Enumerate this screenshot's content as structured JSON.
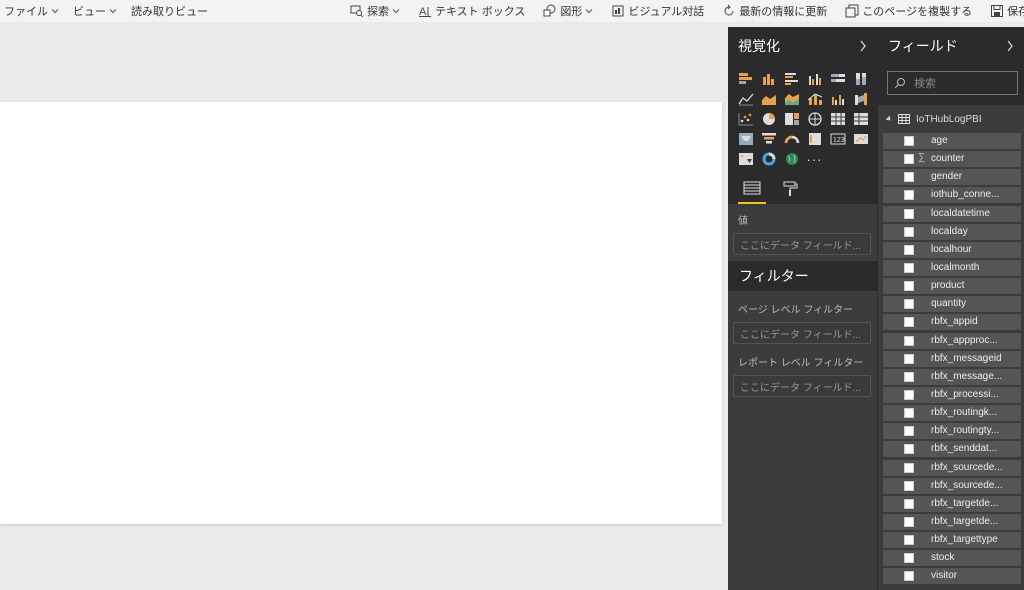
{
  "toolbar": {
    "left": [
      {
        "label": "ファイル"
      },
      {
        "label": "ビュー"
      },
      {
        "label": "読み取りビュー"
      }
    ],
    "right": [
      {
        "label": "探索",
        "icon": "explore-icon",
        "dropdown": true
      },
      {
        "label": "テキスト ボックス",
        "icon": "textbox-icon"
      },
      {
        "label": "図形",
        "icon": "shapes-icon",
        "dropdown": true
      },
      {
        "label": "ビジュアル対話",
        "icon": "visual-interaction-icon"
      },
      {
        "label": "最新の情報に更新",
        "icon": "refresh-icon"
      },
      {
        "label": "このページを複製する",
        "icon": "duplicate-icon"
      },
      {
        "label": "保存",
        "icon": "save-icon"
      }
    ],
    "more": "···"
  },
  "visualizations": {
    "title": "視覚化",
    "values_label": "値",
    "values_placeholder": "ここにデータ フィールド...",
    "more": "···"
  },
  "filters": {
    "title": "フィルター",
    "page_level_label": "ページ レベル フィルター",
    "page_level_placeholder": "ここにデータ フィールド...",
    "report_level_label": "レポート レベル フィルター",
    "report_level_placeholder": "ここにデータ フィールド..."
  },
  "fields": {
    "title": "フィールド",
    "search_placeholder": "検索",
    "table_name": "IoTHubLogPBI",
    "items": [
      {
        "name": "age",
        "sigma": false
      },
      {
        "name": "counter",
        "sigma": true
      },
      {
        "name": "gender",
        "sigma": false
      },
      {
        "name": "iothub_conne...",
        "sigma": false
      },
      {
        "name": "localdatetime",
        "sigma": false
      },
      {
        "name": "localday",
        "sigma": false
      },
      {
        "name": "localhour",
        "sigma": false
      },
      {
        "name": "localmonth",
        "sigma": false
      },
      {
        "name": "product",
        "sigma": false
      },
      {
        "name": "quantity",
        "sigma": false
      },
      {
        "name": "rbfx_appid",
        "sigma": false
      },
      {
        "name": "rbfx_appproc...",
        "sigma": false
      },
      {
        "name": "rbfx_messageid",
        "sigma": false
      },
      {
        "name": "rbfx_message...",
        "sigma": false
      },
      {
        "name": "rbfx_processi...",
        "sigma": false
      },
      {
        "name": "rbfx_routingk...",
        "sigma": false
      },
      {
        "name": "rbfx_routingty...",
        "sigma": false
      },
      {
        "name": "rbfx_senddat...",
        "sigma": false
      },
      {
        "name": "rbfx_sourcede...",
        "sigma": false
      },
      {
        "name": "rbfx_sourcede...",
        "sigma": false
      },
      {
        "name": "rbfx_targetde...",
        "sigma": false
      },
      {
        "name": "rbfx_targetde...",
        "sigma": false
      },
      {
        "name": "rbfx_targettype",
        "sigma": false
      },
      {
        "name": "stock",
        "sigma": false
      },
      {
        "name": "visitor",
        "sigma": false
      }
    ]
  }
}
